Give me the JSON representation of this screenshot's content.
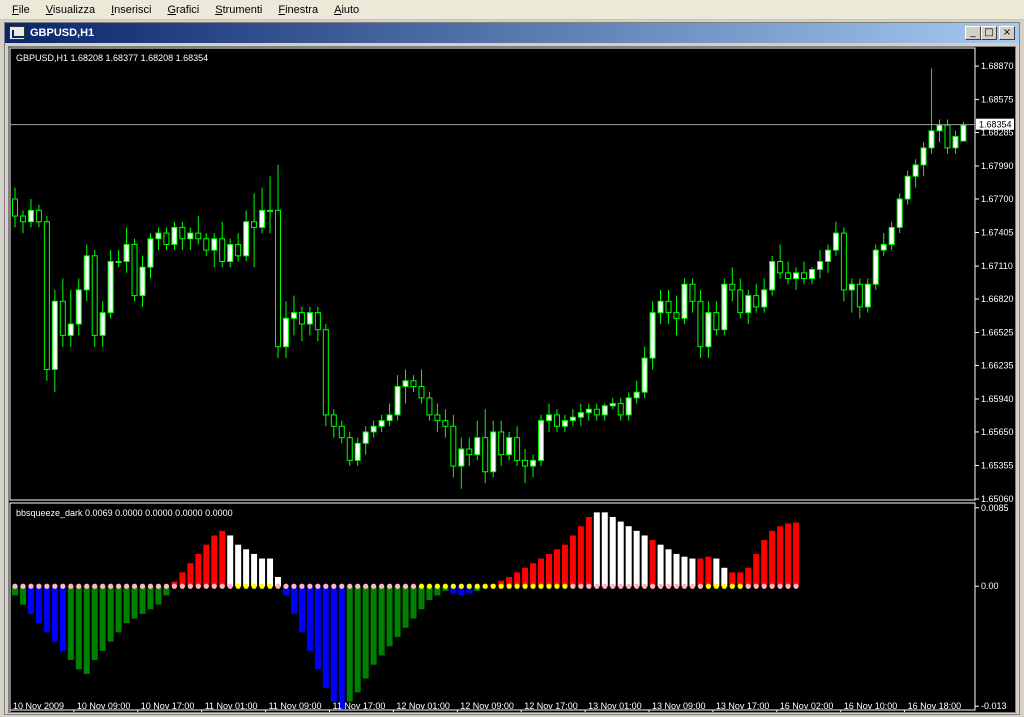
{
  "menu": [
    "File",
    "Visualizza",
    "Inserisci",
    "Grafici",
    "Strumenti",
    "Finestra",
    "Aiuto"
  ],
  "window": {
    "title": "GBPUSD,H1",
    "min_glyph": "_",
    "max_glyph": "□",
    "close_glyph": "×"
  },
  "colors": {
    "bull": "#ffffff",
    "bear": "#000000",
    "wick": "#00ff00",
    "red": "#ff0000",
    "white": "#ffffff",
    "blue": "#0000ff",
    "green": "#008000",
    "pink": "#ffb6c1",
    "yellow": "#ffff00"
  },
  "main_chart": {
    "info": "GBPUSD,H1  1.68208 1.68377 1.68208 1.68354",
    "current_price": "1.68354",
    "y_ticks": [
      "1.68870",
      "1.68575",
      "1.68285",
      "1.67990",
      "1.67700",
      "1.67405",
      "1.67110",
      "1.66820",
      "1.66525",
      "1.66235",
      "1.65940",
      "1.65650",
      "1.65355",
      "1.65060"
    ]
  },
  "indicator": {
    "info": "bbsqueeze_dark 0.0069 0.0000 0.0000 0.0000 0.0000",
    "y_ticks": [
      "0.0085",
      "0.00",
      "-0.013"
    ]
  },
  "x_ticks": [
    "10 Nov 2009",
    "10 Nov 09:00",
    "10 Nov 17:00",
    "11 Nov 01:00",
    "11 Nov 09:00",
    "11 Nov 17:00",
    "12 Nov 01:00",
    "12 Nov 09:00",
    "12 Nov 17:00",
    "13 Nov 01:00",
    "13 Nov 09:00",
    "13 Nov 17:00",
    "16 Nov 02:00",
    "16 Nov 10:00",
    "16 Nov 18:00"
  ],
  "chart_data": [
    {
      "type": "candlestick",
      "title": "GBPUSD,H1",
      "ylim": [
        1.6506,
        1.6902
      ],
      "current_price": 1.68354,
      "candles": [
        {
          "o": 1.677,
          "h": 1.678,
          "l": 1.6745,
          "c": 1.6755
        },
        {
          "o": 1.6755,
          "h": 1.676,
          "l": 1.674,
          "c": 1.675
        },
        {
          "o": 1.675,
          "h": 1.677,
          "l": 1.6745,
          "c": 1.676
        },
        {
          "o": 1.676,
          "h": 1.6765,
          "l": 1.6745,
          "c": 1.675
        },
        {
          "o": 1.675,
          "h": 1.6755,
          "l": 1.661,
          "c": 1.662
        },
        {
          "o": 1.662,
          "h": 1.669,
          "l": 1.66,
          "c": 1.668
        },
        {
          "o": 1.668,
          "h": 1.67,
          "l": 1.664,
          "c": 1.665
        },
        {
          "o": 1.665,
          "h": 1.669,
          "l": 1.664,
          "c": 1.666
        },
        {
          "o": 1.666,
          "h": 1.67,
          "l": 1.665,
          "c": 1.669
        },
        {
          "o": 1.669,
          "h": 1.673,
          "l": 1.668,
          "c": 1.672
        },
        {
          "o": 1.672,
          "h": 1.6725,
          "l": 1.664,
          "c": 1.665
        },
        {
          "o": 1.665,
          "h": 1.668,
          "l": 1.664,
          "c": 1.667
        },
        {
          "o": 1.667,
          "h": 1.6725,
          "l": 1.6665,
          "c": 1.6715
        },
        {
          "o": 1.6715,
          "h": 1.6725,
          "l": 1.671,
          "c": 1.6715
        },
        {
          "o": 1.6715,
          "h": 1.6745,
          "l": 1.6705,
          "c": 1.673
        },
        {
          "o": 1.673,
          "h": 1.6735,
          "l": 1.668,
          "c": 1.6685
        },
        {
          "o": 1.6685,
          "h": 1.672,
          "l": 1.6675,
          "c": 1.671
        },
        {
          "o": 1.671,
          "h": 1.674,
          "l": 1.67,
          "c": 1.6735
        },
        {
          "o": 1.6735,
          "h": 1.6745,
          "l": 1.6725,
          "c": 1.674
        },
        {
          "o": 1.674,
          "h": 1.6745,
          "l": 1.6725,
          "c": 1.673
        },
        {
          "o": 1.673,
          "h": 1.675,
          "l": 1.6725,
          "c": 1.6745
        },
        {
          "o": 1.6745,
          "h": 1.675,
          "l": 1.6725,
          "c": 1.6735
        },
        {
          "o": 1.6735,
          "h": 1.6745,
          "l": 1.6725,
          "c": 1.674
        },
        {
          "o": 1.674,
          "h": 1.6755,
          "l": 1.673,
          "c": 1.6735
        },
        {
          "o": 1.6735,
          "h": 1.674,
          "l": 1.672,
          "c": 1.6725
        },
        {
          "o": 1.6725,
          "h": 1.674,
          "l": 1.671,
          "c": 1.6735
        },
        {
          "o": 1.6735,
          "h": 1.675,
          "l": 1.671,
          "c": 1.6715
        },
        {
          "o": 1.6715,
          "h": 1.6735,
          "l": 1.671,
          "c": 1.673
        },
        {
          "o": 1.673,
          "h": 1.674,
          "l": 1.6715,
          "c": 1.672
        },
        {
          "o": 1.672,
          "h": 1.676,
          "l": 1.6715,
          "c": 1.675
        },
        {
          "o": 1.675,
          "h": 1.6775,
          "l": 1.671,
          "c": 1.6745
        },
        {
          "o": 1.6745,
          "h": 1.678,
          "l": 1.674,
          "c": 1.676
        },
        {
          "o": 1.676,
          "h": 1.679,
          "l": 1.674,
          "c": 1.676
        },
        {
          "o": 1.676,
          "h": 1.68,
          "l": 1.663,
          "c": 1.664
        },
        {
          "o": 1.664,
          "h": 1.668,
          "l": 1.663,
          "c": 1.6665
        },
        {
          "o": 1.6665,
          "h": 1.6685,
          "l": 1.665,
          "c": 1.667
        },
        {
          "o": 1.667,
          "h": 1.6675,
          "l": 1.6645,
          "c": 1.666
        },
        {
          "o": 1.666,
          "h": 1.6675,
          "l": 1.665,
          "c": 1.667
        },
        {
          "o": 1.667,
          "h": 1.6675,
          "l": 1.6645,
          "c": 1.6655
        },
        {
          "o": 1.6655,
          "h": 1.666,
          "l": 1.657,
          "c": 1.658
        },
        {
          "o": 1.658,
          "h": 1.6585,
          "l": 1.656,
          "c": 1.657
        },
        {
          "o": 1.657,
          "h": 1.6575,
          "l": 1.6555,
          "c": 1.656
        },
        {
          "o": 1.656,
          "h": 1.6565,
          "l": 1.6535,
          "c": 1.654
        },
        {
          "o": 1.654,
          "h": 1.656,
          "l": 1.6535,
          "c": 1.6555
        },
        {
          "o": 1.6555,
          "h": 1.657,
          "l": 1.6545,
          "c": 1.6565
        },
        {
          "o": 1.6565,
          "h": 1.6575,
          "l": 1.656,
          "c": 1.657
        },
        {
          "o": 1.657,
          "h": 1.658,
          "l": 1.6565,
          "c": 1.6575
        },
        {
          "o": 1.6575,
          "h": 1.659,
          "l": 1.657,
          "c": 1.658
        },
        {
          "o": 1.658,
          "h": 1.6615,
          "l": 1.6575,
          "c": 1.6605
        },
        {
          "o": 1.6605,
          "h": 1.662,
          "l": 1.659,
          "c": 1.661
        },
        {
          "o": 1.661,
          "h": 1.6615,
          "l": 1.66,
          "c": 1.6605
        },
        {
          "o": 1.6605,
          "h": 1.662,
          "l": 1.659,
          "c": 1.6595
        },
        {
          "o": 1.6595,
          "h": 1.66,
          "l": 1.6575,
          "c": 1.658
        },
        {
          "o": 1.658,
          "h": 1.659,
          "l": 1.6565,
          "c": 1.6575
        },
        {
          "o": 1.6575,
          "h": 1.6585,
          "l": 1.656,
          "c": 1.657
        },
        {
          "o": 1.657,
          "h": 1.658,
          "l": 1.6525,
          "c": 1.6535
        },
        {
          "o": 1.6535,
          "h": 1.656,
          "l": 1.6515,
          "c": 1.655
        },
        {
          "o": 1.655,
          "h": 1.656,
          "l": 1.6535,
          "c": 1.6545
        },
        {
          "o": 1.6545,
          "h": 1.6575,
          "l": 1.654,
          "c": 1.656
        },
        {
          "o": 1.656,
          "h": 1.6585,
          "l": 1.652,
          "c": 1.653
        },
        {
          "o": 1.653,
          "h": 1.6575,
          "l": 1.6525,
          "c": 1.6565
        },
        {
          "o": 1.6565,
          "h": 1.6575,
          "l": 1.6535,
          "c": 1.6545
        },
        {
          "o": 1.6545,
          "h": 1.6565,
          "l": 1.654,
          "c": 1.656
        },
        {
          "o": 1.656,
          "h": 1.657,
          "l": 1.6535,
          "c": 1.654
        },
        {
          "o": 1.654,
          "h": 1.655,
          "l": 1.652,
          "c": 1.6535
        },
        {
          "o": 1.6535,
          "h": 1.6545,
          "l": 1.6525,
          "c": 1.654
        },
        {
          "o": 1.654,
          "h": 1.658,
          "l": 1.6535,
          "c": 1.6575
        },
        {
          "o": 1.6575,
          "h": 1.659,
          "l": 1.6565,
          "c": 1.658
        },
        {
          "o": 1.658,
          "h": 1.6585,
          "l": 1.6565,
          "c": 1.657
        },
        {
          "o": 1.657,
          "h": 1.658,
          "l": 1.6565,
          "c": 1.6575
        },
        {
          "o": 1.6575,
          "h": 1.6585,
          "l": 1.657,
          "c": 1.6578
        },
        {
          "o": 1.6578,
          "h": 1.659,
          "l": 1.657,
          "c": 1.6582
        },
        {
          "o": 1.6582,
          "h": 1.659,
          "l": 1.6575,
          "c": 1.6585
        },
        {
          "o": 1.6585,
          "h": 1.659,
          "l": 1.6575,
          "c": 1.658
        },
        {
          "o": 1.658,
          "h": 1.659,
          "l": 1.6575,
          "c": 1.6588
        },
        {
          "o": 1.6588,
          "h": 1.6595,
          "l": 1.6585,
          "c": 1.659
        },
        {
          "o": 1.659,
          "h": 1.6595,
          "l": 1.6575,
          "c": 1.658
        },
        {
          "o": 1.658,
          "h": 1.66,
          "l": 1.6575,
          "c": 1.6595
        },
        {
          "o": 1.6595,
          "h": 1.661,
          "l": 1.659,
          "c": 1.66
        },
        {
          "o": 1.66,
          "h": 1.664,
          "l": 1.6595,
          "c": 1.663
        },
        {
          "o": 1.663,
          "h": 1.668,
          "l": 1.662,
          "c": 1.667
        },
        {
          "o": 1.667,
          "h": 1.669,
          "l": 1.666,
          "c": 1.668
        },
        {
          "o": 1.668,
          "h": 1.669,
          "l": 1.666,
          "c": 1.667
        },
        {
          "o": 1.667,
          "h": 1.6685,
          "l": 1.665,
          "c": 1.6665
        },
        {
          "o": 1.6665,
          "h": 1.67,
          "l": 1.666,
          "c": 1.6695
        },
        {
          "o": 1.6695,
          "h": 1.67,
          "l": 1.667,
          "c": 1.668
        },
        {
          "o": 1.668,
          "h": 1.669,
          "l": 1.663,
          "c": 1.664
        },
        {
          "o": 1.664,
          "h": 1.668,
          "l": 1.663,
          "c": 1.667
        },
        {
          "o": 1.667,
          "h": 1.668,
          "l": 1.665,
          "c": 1.6655
        },
        {
          "o": 1.6655,
          "h": 1.67,
          "l": 1.665,
          "c": 1.6695
        },
        {
          "o": 1.6695,
          "h": 1.671,
          "l": 1.668,
          "c": 1.669
        },
        {
          "o": 1.669,
          "h": 1.67,
          "l": 1.6665,
          "c": 1.667
        },
        {
          "o": 1.667,
          "h": 1.669,
          "l": 1.666,
          "c": 1.6685
        },
        {
          "o": 1.6685,
          "h": 1.6695,
          "l": 1.667,
          "c": 1.6675
        },
        {
          "o": 1.6675,
          "h": 1.67,
          "l": 1.667,
          "c": 1.669
        },
        {
          "o": 1.669,
          "h": 1.672,
          "l": 1.6685,
          "c": 1.6715
        },
        {
          "o": 1.6715,
          "h": 1.673,
          "l": 1.67,
          "c": 1.6705
        },
        {
          "o": 1.6705,
          "h": 1.6715,
          "l": 1.6695,
          "c": 1.67
        },
        {
          "o": 1.67,
          "h": 1.671,
          "l": 1.669,
          "c": 1.6705
        },
        {
          "o": 1.6705,
          "h": 1.6715,
          "l": 1.6695,
          "c": 1.67
        },
        {
          "o": 1.67,
          "h": 1.671,
          "l": 1.6695,
          "c": 1.6708
        },
        {
          "o": 1.6708,
          "h": 1.6725,
          "l": 1.67,
          "c": 1.6715
        },
        {
          "o": 1.6715,
          "h": 1.673,
          "l": 1.6705,
          "c": 1.6725
        },
        {
          "o": 1.6725,
          "h": 1.675,
          "l": 1.672,
          "c": 1.674
        },
        {
          "o": 1.674,
          "h": 1.6745,
          "l": 1.668,
          "c": 1.669
        },
        {
          "o": 1.669,
          "h": 1.67,
          "l": 1.667,
          "c": 1.6695
        },
        {
          "o": 1.6695,
          "h": 1.67,
          "l": 1.6665,
          "c": 1.6675
        },
        {
          "o": 1.6675,
          "h": 1.67,
          "l": 1.667,
          "c": 1.6695
        },
        {
          "o": 1.6695,
          "h": 1.673,
          "l": 1.669,
          "c": 1.6725
        },
        {
          "o": 1.6725,
          "h": 1.674,
          "l": 1.672,
          "c": 1.673
        },
        {
          "o": 1.673,
          "h": 1.675,
          "l": 1.6725,
          "c": 1.6745
        },
        {
          "o": 1.6745,
          "h": 1.6775,
          "l": 1.674,
          "c": 1.677
        },
        {
          "o": 1.677,
          "h": 1.6795,
          "l": 1.6765,
          "c": 1.679
        },
        {
          "o": 1.679,
          "h": 1.6805,
          "l": 1.678,
          "c": 1.68
        },
        {
          "o": 1.68,
          "h": 1.682,
          "l": 1.679,
          "c": 1.6815
        },
        {
          "o": 1.6815,
          "h": 1.6885,
          "l": 1.681,
          "c": 1.683
        },
        {
          "o": 1.683,
          "h": 1.684,
          "l": 1.682,
          "c": 1.6835
        },
        {
          "o": 1.6835,
          "h": 1.684,
          "l": 1.681,
          "c": 1.6815
        },
        {
          "o": 1.6815,
          "h": 1.683,
          "l": 1.681,
          "c": 1.6825
        },
        {
          "o": 1.6821,
          "h": 1.6838,
          "l": 1.6821,
          "c": 1.6835
        }
      ]
    },
    {
      "type": "bar",
      "title": "bbsqueeze_dark",
      "ylim": [
        -0.0133,
        0.0088
      ],
      "values": [
        -0.001,
        -0.002,
        -0.003,
        -0.004,
        -0.005,
        -0.006,
        -0.007,
        -0.008,
        -0.009,
        -0.0095,
        -0.008,
        -0.007,
        -0.006,
        -0.005,
        -0.004,
        -0.0035,
        -0.003,
        -0.0025,
        -0.002,
        -0.001,
        0.0005,
        0.0015,
        0.0025,
        0.0035,
        0.0045,
        0.0055,
        0.006,
        0.0055,
        0.0045,
        0.004,
        0.0035,
        0.003,
        0.003,
        0.001,
        -0.001,
        -0.003,
        -0.005,
        -0.007,
        -0.009,
        -0.011,
        -0.0125,
        -0.0133,
        -0.0125,
        -0.0115,
        -0.01,
        -0.0085,
        -0.0075,
        -0.0065,
        -0.0055,
        -0.0045,
        -0.0035,
        -0.0025,
        -0.0015,
        -0.001,
        -0.0005,
        -0.0008,
        -0.001,
        -0.0008,
        -0.0005,
        -0.0002,
        0.0002,
        0.0006,
        0.001,
        0.0015,
        0.002,
        0.0025,
        0.003,
        0.0035,
        0.004,
        0.0045,
        0.0055,
        0.0065,
        0.0075,
        0.008,
        0.008,
        0.0075,
        0.007,
        0.0065,
        0.006,
        0.0055,
        0.005,
        0.0045,
        0.004,
        0.0035,
        0.0032,
        0.003,
        0.003,
        0.0032,
        0.003,
        0.002,
        0.0015,
        0.0015,
        0.002,
        0.0035,
        0.005,
        0.006,
        0.0065,
        0.0068,
        0.0069
      ],
      "colors": [
        "green",
        "green",
        "blue",
        "blue",
        "blue",
        "blue",
        "blue",
        "green",
        "green",
        "green",
        "green",
        "green",
        "green",
        "green",
        "green",
        "green",
        "green",
        "green",
        "green",
        "green",
        "red",
        "red",
        "red",
        "red",
        "red",
        "red",
        "red",
        "white",
        "white",
        "white",
        "white",
        "white",
        "white",
        "white",
        "blue",
        "blue",
        "blue",
        "blue",
        "blue",
        "blue",
        "blue",
        "blue",
        "green",
        "green",
        "green",
        "green",
        "green",
        "green",
        "green",
        "green",
        "green",
        "green",
        "green",
        "green",
        "green",
        "blue",
        "blue",
        "blue",
        "green",
        "green",
        "red",
        "red",
        "red",
        "red",
        "red",
        "red",
        "red",
        "red",
        "red",
        "red",
        "red",
        "red",
        "red",
        "white",
        "white",
        "white",
        "white",
        "white",
        "white",
        "white",
        "red",
        "white",
        "white",
        "white",
        "white",
        "white",
        "red",
        "red",
        "white",
        "white",
        "red",
        "red",
        "red",
        "red",
        "red",
        "red",
        "red",
        "red",
        "red"
      ],
      "dots": [
        "pink",
        "pink",
        "pink",
        "pink",
        "pink",
        "pink",
        "pink",
        "pink",
        "pink",
        "pink",
        "pink",
        "pink",
        "pink",
        "pink",
        "pink",
        "pink",
        "pink",
        "pink",
        "pink",
        "pink",
        "pink",
        "pink",
        "pink",
        "pink",
        "pink",
        "pink",
        "pink",
        "pink",
        "yellow",
        "yellow",
        "yellow",
        "yellow",
        "yellow",
        "pink",
        "pink",
        "pink",
        "pink",
        "pink",
        "pink",
        "pink",
        "pink",
        "pink",
        "pink",
        "pink",
        "pink",
        "pink",
        "pink",
        "pink",
        "pink",
        "pink",
        "pink",
        "yellow",
        "yellow",
        "yellow",
        "yellow",
        "yellow",
        "yellow",
        "yellow",
        "yellow",
        "yellow",
        "yellow",
        "yellow",
        "yellow",
        "yellow",
        "yellow",
        "yellow",
        "yellow",
        "yellow",
        "yellow",
        "yellow",
        "pink",
        "pink",
        "pink",
        "pink",
        "pink",
        "pink",
        "pink",
        "pink",
        "pink",
        "pink",
        "pink",
        "pink",
        "pink",
        "pink",
        "pink",
        "pink",
        "pink",
        "yellow",
        "yellow",
        "yellow",
        "yellow",
        "yellow",
        "pink",
        "pink",
        "pink",
        "pink",
        "pink",
        "pink",
        "pink"
      ]
    }
  ]
}
